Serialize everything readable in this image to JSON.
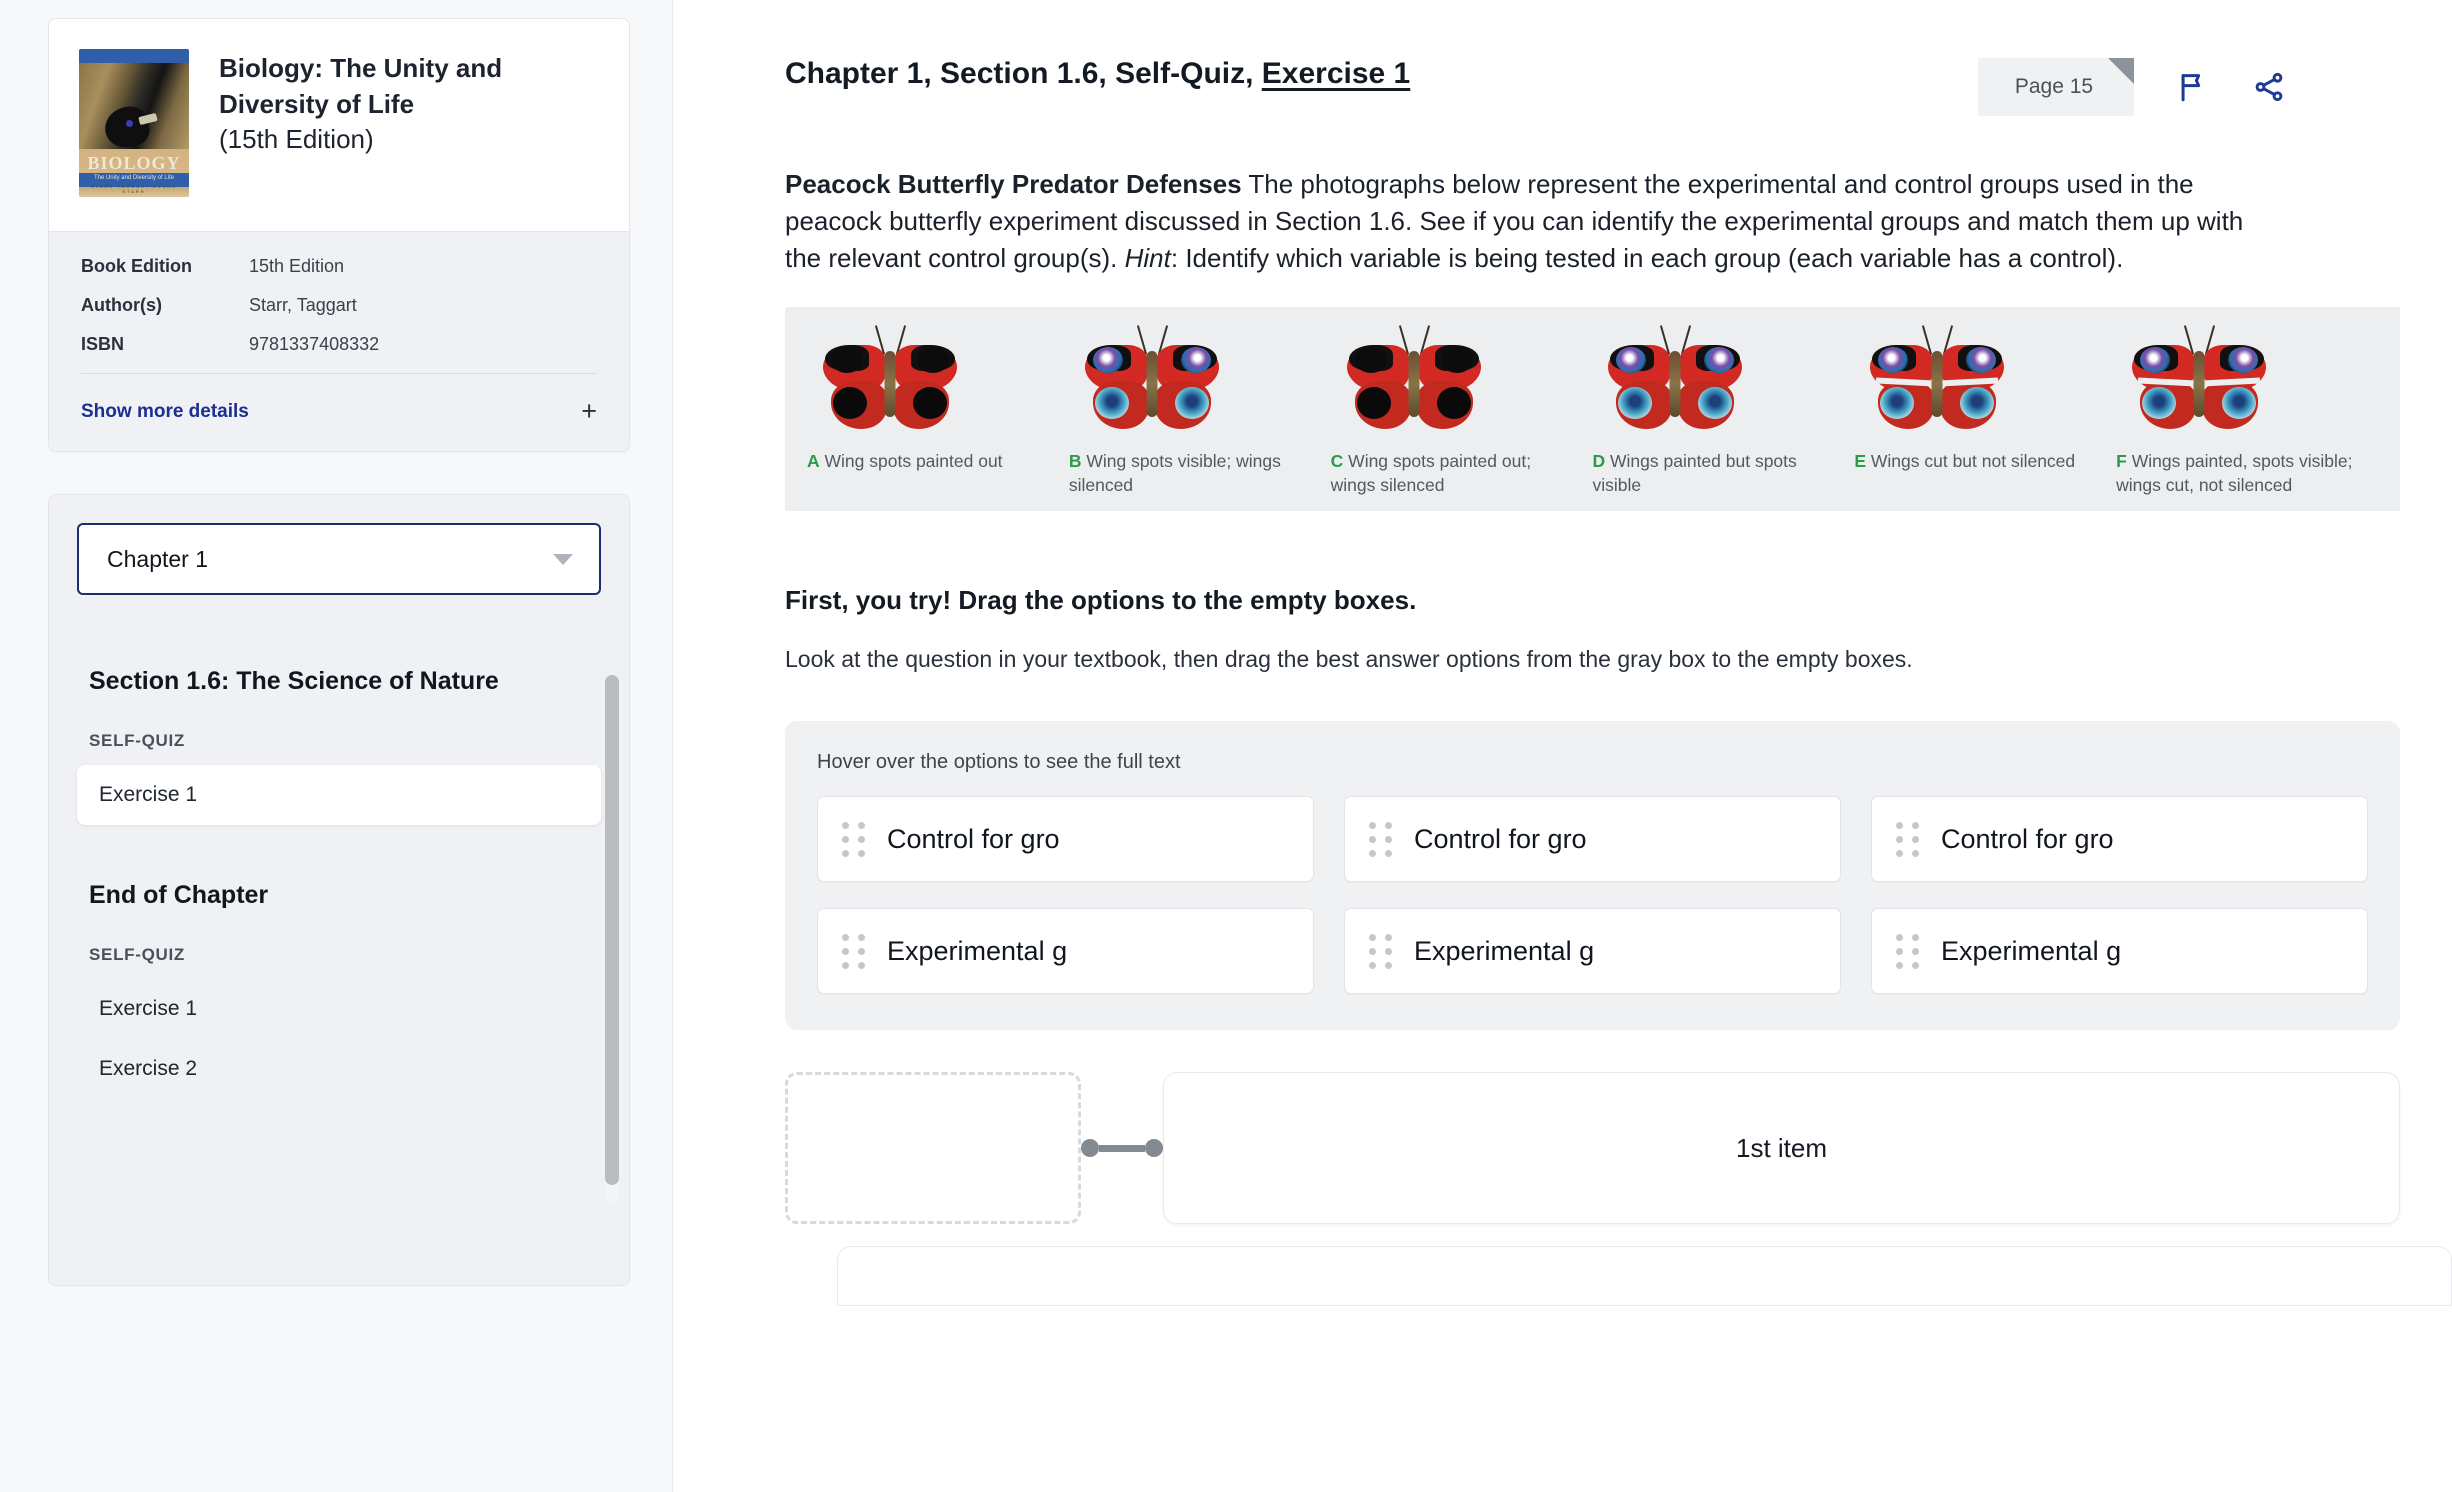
{
  "sidebar": {
    "book": {
      "title": "Biology: The Unity and Diversity of Life",
      "edition_paren": "(15th Edition)",
      "cover_title": "BIOLOGY",
      "cover_subtitle": "The Unity and Diversity of Life",
      "cover_authors": "STARR   TAGGART   EVERS   STARR"
    },
    "details": [
      {
        "key": "Book Edition",
        "value": "15th Edition"
      },
      {
        "key": "Author(s)",
        "value": "Starr, Taggart"
      },
      {
        "key": "ISBN",
        "value": "9781337408332"
      }
    ],
    "show_more_label": "Show more details",
    "show_more_plus": "+",
    "chapter_select": {
      "value": "Chapter 1",
      "icon": "chevron-down-icon"
    },
    "toc": {
      "section_title": "Section 1.6: The Science of Nature",
      "section_group_label": "SELF-QUIZ",
      "section_items": [
        "Exercise 1"
      ],
      "end_title": "End of Chapter",
      "end_group_label": "SELF-QUIZ",
      "end_items": [
        "Exercise 1",
        "Exercise 2"
      ]
    }
  },
  "main": {
    "breadcrumb_prefix": "Chapter 1, Section 1.6, Self-Quiz, ",
    "breadcrumb_current": "Exercise 1",
    "page_badge": "Page 15",
    "icons": {
      "flag": "flag-icon",
      "share": "share-icon"
    },
    "question": {
      "lead_bold": "Peacock Butterfly Predator Defenses",
      "text_1": " The photographs below represent the experimental and control groups used in the peacock butterfly experiment discussed in Section 1.6. See if you can identify the experimental groups and match them up with the relevant control group(s). ",
      "hint_label": "Hint",
      "text_2": ": Identify which variable is being tested in each group (each variable has a control)."
    },
    "figure": [
      {
        "letter": "A",
        "caption": "Wing spots painted out",
        "spots": "black",
        "cut": false
      },
      {
        "letter": "B",
        "caption": "Wing spots visible; wings silenced",
        "spots": "eyes",
        "cut": false
      },
      {
        "letter": "C",
        "caption": "Wing spots painted out; wings silenced",
        "spots": "black",
        "cut": false
      },
      {
        "letter": "D",
        "caption": "Wings painted but spots visible",
        "spots": "eyes",
        "cut": false
      },
      {
        "letter": "E",
        "caption": "Wings cut but not silenced",
        "spots": "eyes",
        "cut": true
      },
      {
        "letter": "F",
        "caption": "Wings painted, spots visible; wings cut, not silenced",
        "spots": "eyes",
        "cut": true
      }
    ],
    "try_title": "First, you try! Drag the options to the empty boxes.",
    "try_sub": "Look at the question in your textbook, then drag the best answer options from the gray box to the empty boxes.",
    "drag": {
      "hint": "Hover over the options to see the full text",
      "options": [
        "Control for gro",
        "Control for gro",
        "Control for gro",
        "Experimental g",
        "Experimental g",
        "Experimental g"
      ]
    },
    "match": {
      "answer_label": "1st item"
    }
  },
  "colors": {
    "accent_blue": "#1a2f8f",
    "page_bg": "#f7f8fa",
    "panel_gray": "#eff1f3",
    "figure_bg": "#edeeef",
    "letter_green": "#2e9a4a"
  }
}
